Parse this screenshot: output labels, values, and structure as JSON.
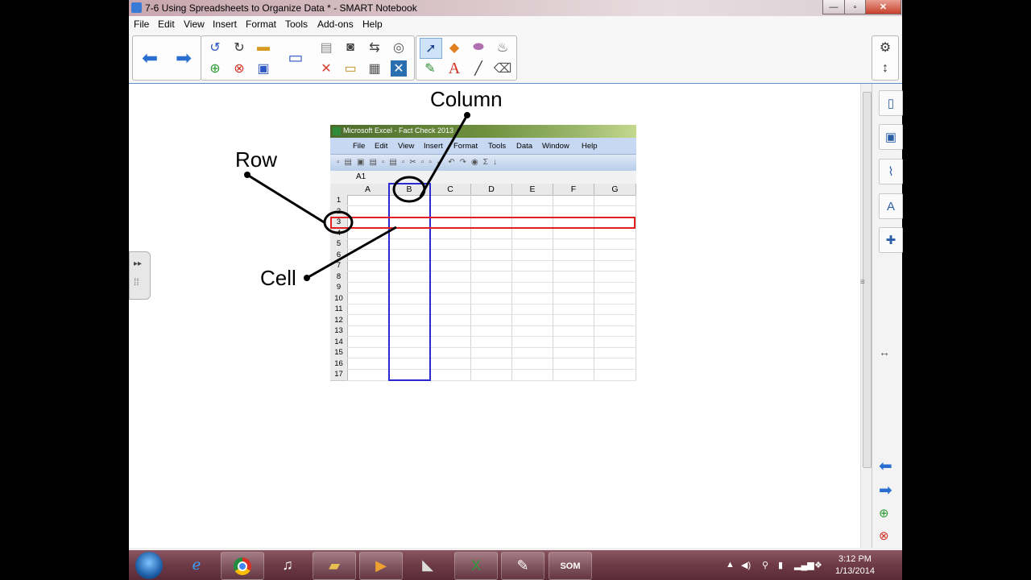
{
  "window": {
    "title": "7-6 Using Spreadsheets to Organize Data * - SMART Notebook",
    "controls": {
      "minimize": "—",
      "maximize": "▫",
      "close": "✕"
    }
  },
  "menu": [
    "File",
    "Edit",
    "View",
    "Insert",
    "Format",
    "Tools",
    "Add-ons",
    "Help"
  ],
  "toolbar_icons": {
    "group1": [
      "back-arrow-icon",
      "forward-arrow-icon"
    ],
    "group2": [
      "undo-icon",
      "redo-icon",
      "open-folder-icon",
      "add-page-icon",
      "delete-page-icon",
      "save-icon",
      "display-icon",
      "paste-icon",
      "delete-icon",
      "screen-shade-icon",
      "table-icon",
      "capture-icon",
      "fullscreen-icon",
      "close-box-icon"
    ],
    "group3": [
      "select-icon",
      "shapes-icon",
      "eraser-icon",
      "magic-pen-icon",
      "pens-icon",
      "text-icon",
      "line-icon",
      "eraser-tool-icon"
    ]
  },
  "sidebar_icons": [
    "page-sorter-icon",
    "gallery-icon",
    "attachments-icon",
    "properties-icon",
    "addons-icon"
  ],
  "sidebar_bottom_icons": [
    "previous-page-icon",
    "next-page-icon",
    "add-page-icon",
    "delete-page-icon"
  ],
  "slide": {
    "labels": {
      "column": "Column",
      "row": "Row",
      "cell": "Cell"
    },
    "excel": {
      "title": "Microsoft Excel - Fact Check 2013",
      "menu": [
        "File",
        "Edit",
        "View",
        "Insert",
        "Format",
        "Tools",
        "Data",
        "Window",
        "Help"
      ],
      "namebox": "A1",
      "columns": [
        "A",
        "B",
        "C",
        "D",
        "E",
        "F",
        "G"
      ],
      "rows": [
        "1",
        "2",
        "3",
        "4",
        "5",
        "6",
        "7",
        "8",
        "9",
        "10",
        "11",
        "12",
        "13",
        "14",
        "15",
        "16",
        "17"
      ],
      "highlight_row": "3",
      "highlight_column": "B",
      "row_highlight_color": "#e02020",
      "column_highlight_color": "#2a2ad0"
    }
  },
  "taskbar": {
    "apps": [
      "internet-explorer-icon",
      "chrome-icon",
      "itunes-icon",
      "explorer-icon",
      "media-player-icon",
      "utility-icon",
      "excel-icon",
      "notebook-icon",
      "som-icon"
    ],
    "clock": {
      "time": "3:12 PM",
      "date": "1/13/2014"
    }
  }
}
